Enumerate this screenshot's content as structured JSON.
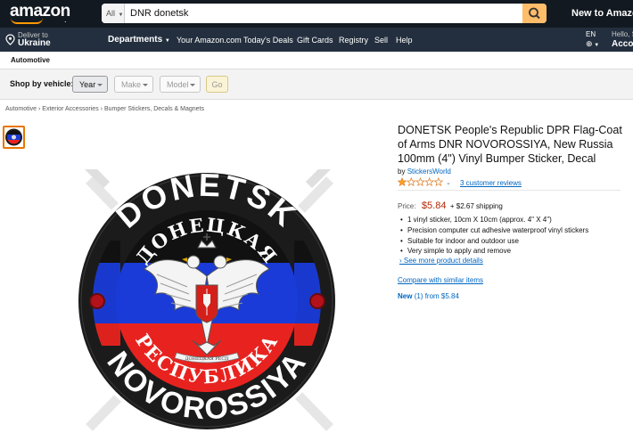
{
  "nav": {
    "logo": "amazon",
    "logo_suffix": ".",
    "search_category": "All",
    "search_value": "DNR donetsk",
    "right_text": "New to Amazon",
    "deliver_line1": "Deliver to",
    "deliver_line2": "Ukraine",
    "links": [
      "Departments",
      "Your Amazon.com",
      "Today's Deals",
      "Gift Cards",
      "Registry",
      "Sell",
      "Help"
    ],
    "language": "EN",
    "hello": "Hello, Sign in",
    "account": "Account"
  },
  "subnav": {
    "label": "Automotive"
  },
  "vehicle": {
    "label": "Shop by vehicle:",
    "year": "Year",
    "make": "Make",
    "model": "Model",
    "go": "Go"
  },
  "breadcrumb": [
    "Automotive",
    "Exterior Accessories",
    "Bumper Stickers, Decals & Magnets"
  ],
  "breadcrumb_sep": "›",
  "sticker": {
    "top_text": "DONETSK",
    "cyrillic_top": "ДОНЕЦКАЯ",
    "cyrillic_bottom": "РЕСПУБЛИКА",
    "bottom_text": "NOVOROSSIYA",
    "ribbon_text": "ДОНЕЦКАЯ РЕСП",
    "colors": {
      "black": "#111111",
      "blue": "#1a3bd8",
      "red": "#e8231f",
      "ring": "#1b1b1b"
    }
  },
  "product": {
    "title": "DONETSK People's Republic DPR Flag-Coat of Arms DNR NOVOROSSIYA, New Russia 100mm (4\") Vinyl Bumper Sticker, Decal",
    "by": "by",
    "brand": "StickersWorld",
    "rating": 1,
    "rating_max": 5,
    "reviews": "3 customer reviews",
    "price_label": "Price:",
    "price": "$5.84",
    "shipping": "+ $2.67 shipping",
    "bullets": [
      "1 vinyl sticker, 10cm X 10cm (approx. 4\" X 4\")",
      "Precision computer cut adhesive waterproof vinyl stickers",
      "Suitable for indoor and outdoor use",
      "Very simple to apply and remove"
    ],
    "see_more": "› See more product details",
    "compare": "Compare with similar items",
    "new_label": "New",
    "new_offer": "(1) from $5.84"
  },
  "colors": {
    "nav_bg": "#131921",
    "nav2_bg": "#232f3e",
    "search_btn": "#febd69",
    "link": "#0066c0",
    "price": "#b12704",
    "star": "#ffa41c"
  },
  "icons": {
    "search": "search-icon",
    "pin": "location-pin-icon",
    "globe": "globe-icon",
    "star": "star-icon"
  }
}
